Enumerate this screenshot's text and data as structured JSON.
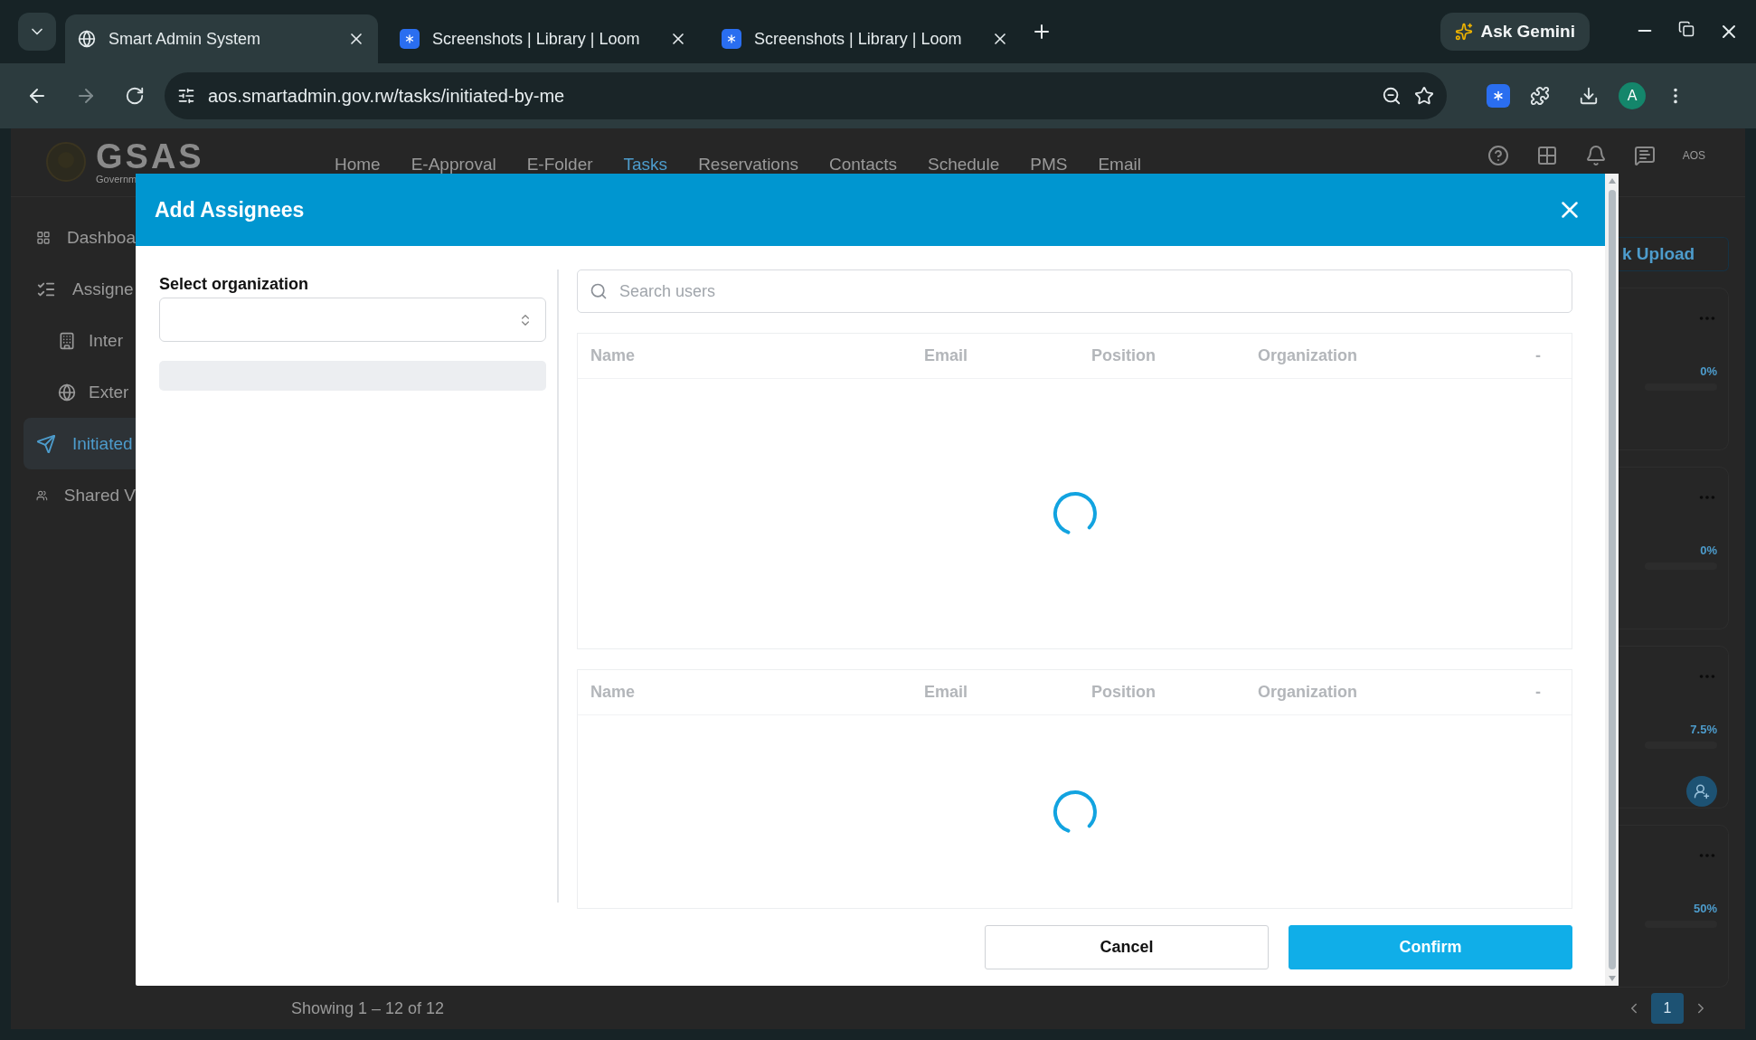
{
  "browser": {
    "tabs": [
      {
        "title": "Smart Admin System",
        "selected": true,
        "kind": "site"
      },
      {
        "title": "Screenshots | Library | Loom",
        "selected": false,
        "kind": "loom"
      },
      {
        "title": "Screenshots | Library | Loom",
        "selected": false,
        "kind": "loom"
      }
    ],
    "assistant": "Ask Gemini",
    "url": "aos.smartadmin.gov.rw/tasks/initiated-by-me",
    "profile": "A"
  },
  "page": {
    "logo": "GSAS",
    "logo_subtitle": "Governm",
    "nav": [
      {
        "label": "Home",
        "selected": false
      },
      {
        "label": "E-Approval",
        "selected": false
      },
      {
        "label": "E-Folder",
        "selected": false
      },
      {
        "label": "Tasks",
        "selected": true
      },
      {
        "label": "Reservations",
        "selected": false
      },
      {
        "label": "Contacts",
        "selected": false
      },
      {
        "label": "Schedule",
        "selected": false
      },
      {
        "label": "PMS",
        "selected": false
      },
      {
        "label": "Email",
        "selected": false
      }
    ],
    "account": "AOS",
    "sidebar": [
      {
        "label": "Dashboa",
        "selected": false
      },
      {
        "label": "Assigne",
        "selected": false,
        "children": [
          {
            "label": "Inter",
            "selected": false
          },
          {
            "label": "Exter",
            "selected": false
          }
        ]
      },
      {
        "label": "Initiated",
        "selected": true
      },
      {
        "label": "Shared V",
        "selected": false
      }
    ],
    "upload_button": "k Upload",
    "cards": [
      {
        "progress": "0%",
        "assignee": false
      },
      {
        "progress": "0%",
        "assignee": false
      },
      {
        "progress": "7.5%",
        "assignee": true
      },
      {
        "progress": "50%",
        "assignee": false
      }
    ],
    "footer": "Showing 1 – 12 of 12",
    "pages": [
      {
        "label": "1",
        "selected": true
      }
    ]
  },
  "modal": {
    "title": "Add Assignees",
    "org_label": "Select organization",
    "search_placeholder": "Search users",
    "tables": [
      {
        "columns": [
          "Name",
          "Email",
          "Position",
          "Organization",
          "-"
        ],
        "loading": true
      },
      {
        "columns": [
          "Name",
          "Email",
          "Position",
          "Organization",
          "-"
        ],
        "loading": true
      }
    ],
    "buttons": [
      {
        "label": "Cancel",
        "kind": "secondary"
      },
      {
        "label": "Confirm",
        "kind": "primary"
      }
    ]
  }
}
